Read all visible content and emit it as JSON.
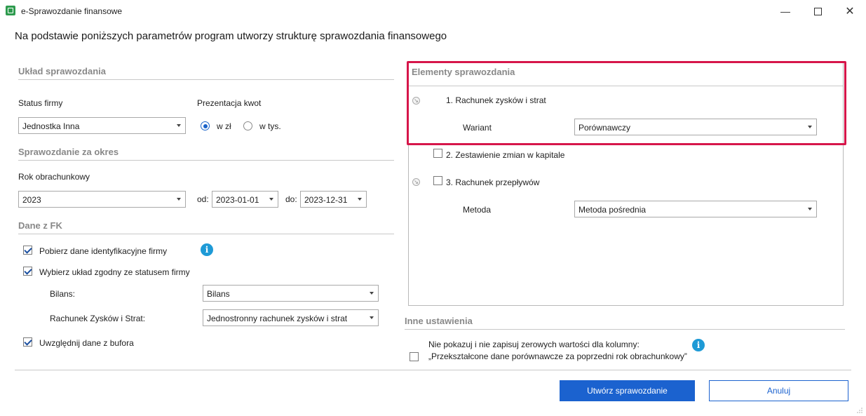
{
  "window": {
    "title": "e-Sprawozdanie finansowe",
    "headline": "Na podstawie poniższych parametrów program utworzy strukturę sprawozdania finansowego"
  },
  "uklad": {
    "title": "Układ sprawozdania",
    "status_label": "Status firmy",
    "status_value": "Jednostka Inna",
    "prezentacja_label": "Prezentacja kwot",
    "radio_zl": "w zł",
    "radio_tys": "w tys.",
    "selected": "w zł"
  },
  "okres": {
    "title": "Sprawozdanie za okres",
    "rok_label": "Rok obrachunkowy",
    "rok_value": "2023",
    "od_label": "od:",
    "od_value": "2023-01-01",
    "do_label": "do:",
    "do_value": "2023-12-31"
  },
  "fk": {
    "title": "Dane z FK",
    "cb1": "Pobierz dane identyfikacyjne firmy",
    "cb1_checked": true,
    "cb2": "Wybierz układ zgodny ze statusem firmy",
    "cb2_checked": true,
    "bilans_label": "Bilans:",
    "bilans_value": "Bilans",
    "rzis_label": "Rachunek Zysków i Strat:",
    "rzis_value": "Jednostronny rachunek zysków i strat",
    "cb3": "Uwzględnij dane z bufora",
    "cb3_checked": true
  },
  "elementy": {
    "title": "Elementy sprawozdania",
    "item1": "1. Rachunek zysków i strat",
    "wariant_label": "Wariant",
    "wariant_value": "Porównawczy",
    "item2": "2. Zestawienie zmian w kapitale",
    "item2_checked": false,
    "item3": "3. Rachunek przepływów",
    "item3_checked": false,
    "metoda_label": "Metoda",
    "metoda_value": "Metoda pośrednia"
  },
  "inne": {
    "title": "Inne ustawienia",
    "cb_line1": "Nie pokazuj i nie zapisuj zerowych wartości dla kolumny:",
    "cb_line2": "„Przekształcone dane porównawcze za poprzedni rok obrachunkowy”",
    "cb_checked": false
  },
  "buttons": {
    "create": "Utwórz sprawozdanie",
    "cancel": "Anuluj"
  },
  "colors": {
    "accent": "#1b62cf",
    "highlight": "#d6164a",
    "info": "#1e9ad6"
  },
  "icons": {
    "minimize": "minimize-icon",
    "maximize": "maximize-icon",
    "close": "close-icon",
    "info": "info-icon",
    "expand": "expand-icon"
  }
}
